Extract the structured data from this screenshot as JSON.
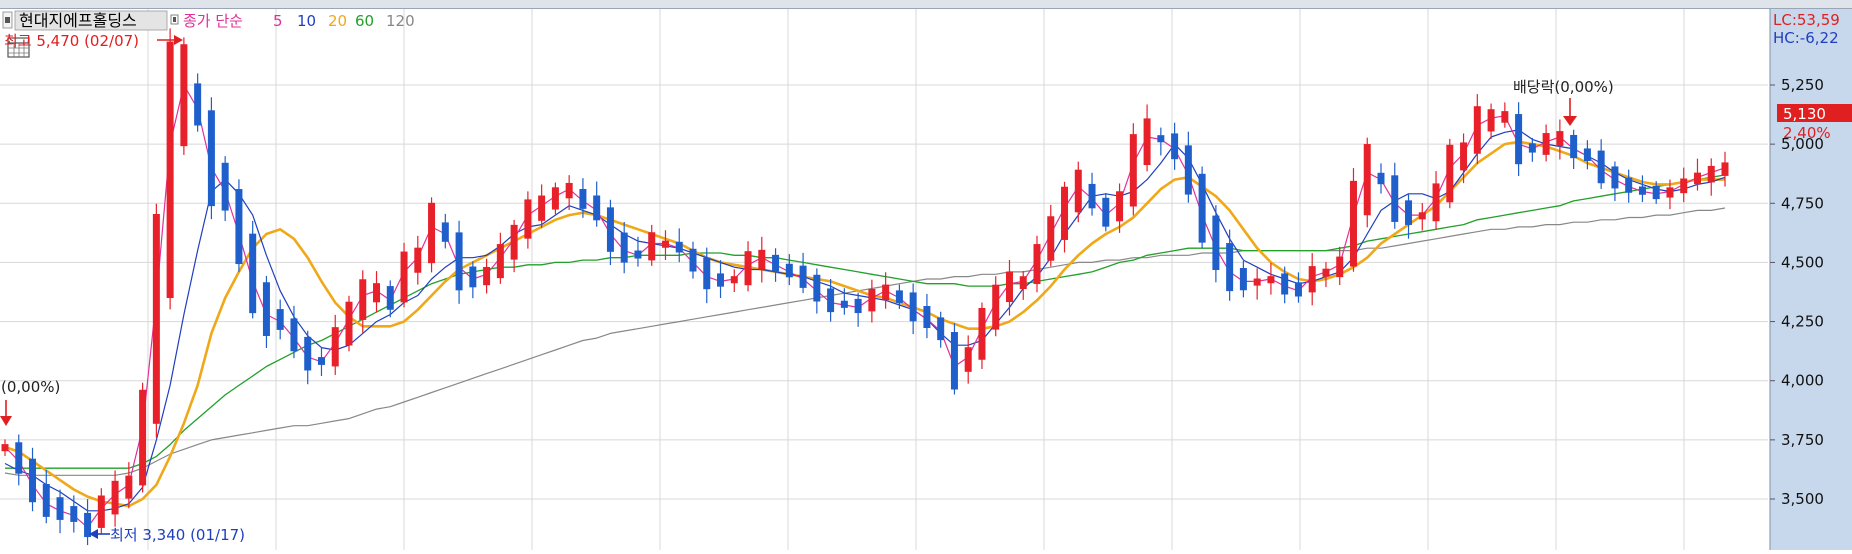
{
  "header": {
    "stock_name": "현대지에프홀딩스",
    "indicator_label": "종가 단순",
    "ma_periods": [
      "5",
      "10",
      "20",
      "60",
      "120"
    ],
    "ma_colors": [
      "#e0309a",
      "#1f3fbf",
      "#f0a818",
      "#22a02a",
      "#888888"
    ]
  },
  "right_top": {
    "lc": "LC:53,59",
    "hc": "HC:-6,22"
  },
  "current": {
    "price_label": "5,130",
    "change_label": "2,40%",
    "color": "#e02020"
  },
  "annotations": {
    "high_label": "최고 5,470 (02/07)",
    "low_label": "최저 3,340 (01/17)",
    "dividend_label": "배당락(0,00%)",
    "left_pct_label": "(0,00%)"
  },
  "colors": {
    "up": "#e8202a",
    "down": "#1f5fcc",
    "grid": "#d8d8d8",
    "axis_bg": "#c8d8ec"
  },
  "chart_data": {
    "type": "candlestick",
    "y_axis": {
      "ticks": [
        "5,250",
        "5,000",
        "4,750",
        "4,500",
        "4,250",
        "4,000",
        "3,750",
        "3,500"
      ],
      "range": [
        3300,
        5550
      ]
    },
    "high": {
      "value": 5470,
      "date": "02/07"
    },
    "low": {
      "value": 3340,
      "date": "01/17"
    },
    "last_close": 5130,
    "change_pct": 2.4,
    "series": [
      {
        "name": "5",
        "values": [
          3720,
          3660,
          3560,
          3480,
          3450,
          3430,
          3380,
          3460,
          3520,
          3560,
          3800,
          4350,
          5000,
          5250,
          5150,
          4900,
          4800,
          4620,
          4420,
          4280,
          4250,
          4180,
          4100,
          4080,
          4160,
          4260,
          4360,
          4380,
          4340,
          4460,
          4520,
          4650,
          4620,
          4480,
          4430,
          4450,
          4520,
          4600,
          4700,
          4740,
          4780,
          4810,
          4760,
          4720,
          4620,
          4550,
          4530,
          4580,
          4580,
          4560,
          4500,
          4440,
          4420,
          4430,
          4490,
          4520,
          4490,
          4460,
          4430,
          4380,
          4330,
          4320,
          4310,
          4350,
          4380,
          4350,
          4300,
          4260,
          4210,
          4060,
          4100,
          4220,
          4330,
          4410,
          4420,
          4510,
          4620,
          4730,
          4820,
          4770,
          4700,
          4750,
          4920,
          5030,
          5020,
          4980,
          4870,
          4700,
          4560,
          4460,
          4420,
          4420,
          4430,
          4400,
          4380,
          4440,
          4460,
          4490,
          4700,
          4880,
          4850,
          4750,
          4700,
          4700,
          4770,
          4900,
          4960,
          5080,
          5110,
          5120,
          5000,
          4980,
          5010,
          5030,
          4980,
          4950,
          4890,
          4850,
          4820,
          4800,
          4790,
          4800,
          4830,
          4860,
          4880,
          4900
        ]
      },
      {
        "name": "10",
        "values": [
          3650,
          3620,
          3600,
          3560,
          3530,
          3490,
          3450,
          3450,
          3460,
          3480,
          3550,
          3750,
          3980,
          4280,
          4550,
          4800,
          4850,
          4790,
          4700,
          4530,
          4380,
          4270,
          4190,
          4140,
          4130,
          4150,
          4200,
          4250,
          4280,
          4330,
          4360,
          4430,
          4480,
          4520,
          4520,
          4530,
          4570,
          4620,
          4650,
          4660,
          4700,
          4740,
          4720,
          4700,
          4660,
          4620,
          4590,
          4580,
          4570,
          4560,
          4540,
          4520,
          4500,
          4480,
          4470,
          4470,
          4460,
          4450,
          4440,
          4420,
          4400,
          4370,
          4360,
          4350,
          4340,
          4320,
          4300,
          4260,
          4200,
          4150,
          4150,
          4170,
          4240,
          4310,
          4390,
          4440,
          4520,
          4620,
          4700,
          4780,
          4790,
          4780,
          4800,
          4850,
          4920,
          5000,
          4940,
          4830,
          4710,
          4600,
          4510,
          4480,
          4450,
          4430,
          4410,
          4420,
          4440,
          4460,
          4520,
          4620,
          4720,
          4760,
          4790,
          4790,
          4770,
          4800,
          4880,
          4960,
          5030,
          5050,
          5060,
          5020,
          5000,
          4990,
          4980,
          4950,
          4920,
          4880,
          4850,
          4830,
          4810,
          4800,
          4810,
          4830,
          4840,
          4860
        ]
      },
      {
        "name": "20",
        "values": [
          3720,
          3700,
          3660,
          3620,
          3580,
          3540,
          3510,
          3490,
          3480,
          3470,
          3500,
          3560,
          3680,
          3820,
          3980,
          4200,
          4350,
          4460,
          4560,
          4620,
          4640,
          4600,
          4520,
          4420,
          4330,
          4270,
          4230,
          4230,
          4230,
          4250,
          4300,
          4360,
          4420,
          4470,
          4500,
          4530,
          4560,
          4590,
          4620,
          4650,
          4680,
          4700,
          4710,
          4700,
          4680,
          4660,
          4640,
          4620,
          4600,
          4580,
          4550,
          4520,
          4500,
          4490,
          4480,
          4470,
          4460,
          4450,
          4440,
          4430,
          4420,
          4400,
          4380,
          4360,
          4350,
          4330,
          4310,
          4290,
          4260,
          4240,
          4220,
          4220,
          4230,
          4250,
          4290,
          4340,
          4400,
          4470,
          4530,
          4580,
          4620,
          4650,
          4690,
          4750,
          4810,
          4850,
          4860,
          4820,
          4780,
          4720,
          4640,
          4560,
          4500,
          4460,
          4430,
          4420,
          4430,
          4450,
          4480,
          4520,
          4580,
          4620,
          4660,
          4700,
          4740,
          4800,
          4860,
          4920,
          4960,
          5000,
          5010,
          5000,
          4990,
          4970,
          4950,
          4920,
          4900,
          4880,
          4860,
          4840,
          4830,
          4830,
          4840,
          4850,
          4850,
          4850
        ]
      },
      {
        "name": "60",
        "values": [
          3630,
          3630,
          3630,
          3630,
          3630,
          3630,
          3630,
          3630,
          3630,
          3630,
          3650,
          3680,
          3730,
          3790,
          3840,
          3890,
          3940,
          3980,
          4020,
          4060,
          4090,
          4120,
          4150,
          4170,
          4200,
          4230,
          4260,
          4290,
          4320,
          4350,
          4380,
          4410,
          4430,
          4450,
          4460,
          4470,
          4480,
          4480,
          4490,
          4490,
          4500,
          4500,
          4510,
          4510,
          4520,
          4520,
          4530,
          4530,
          4530,
          4530,
          4540,
          4540,
          4540,
          4530,
          4530,
          4520,
          4520,
          4510,
          4500,
          4490,
          4480,
          4470,
          4460,
          4450,
          4440,
          4430,
          4420,
          4410,
          4410,
          4410,
          4400,
          4400,
          4400,
          4410,
          4410,
          4420,
          4430,
          4440,
          4450,
          4460,
          4480,
          4500,
          4510,
          4530,
          4540,
          4550,
          4560,
          4560,
          4560,
          4560,
          4550,
          4550,
          4550,
          4550,
          4550,
          4550,
          4550,
          4560,
          4570,
          4590,
          4600,
          4610,
          4620,
          4630,
          4640,
          4650,
          4660,
          4680,
          4690,
          4700,
          4710,
          4720,
          4730,
          4740,
          4760,
          4770,
          4780,
          4790,
          4800,
          4810,
          4820,
          4830,
          4840,
          4850,
          4860,
          4870
        ]
      },
      {
        "name": "120",
        "values": [
          3610,
          3600,
          3600,
          3600,
          3600,
          3600,
          3600,
          3600,
          3600,
          3610,
          3630,
          3660,
          3690,
          3710,
          3730,
          3750,
          3760,
          3770,
          3780,
          3790,
          3800,
          3810,
          3810,
          3820,
          3830,
          3840,
          3860,
          3880,
          3890,
          3910,
          3930,
          3950,
          3970,
          3990,
          4010,
          4030,
          4050,
          4070,
          4090,
          4110,
          4130,
          4150,
          4170,
          4180,
          4200,
          4210,
          4220,
          4230,
          4240,
          4250,
          4260,
          4270,
          4280,
          4290,
          4300,
          4310,
          4320,
          4330,
          4340,
          4350,
          4360,
          4370,
          4380,
          4390,
          4400,
          4410,
          4420,
          4430,
          4430,
          4440,
          4440,
          4450,
          4450,
          4460,
          4460,
          4470,
          4480,
          4490,
          4500,
          4500,
          4510,
          4510,
          4520,
          4520,
          4530,
          4530,
          4530,
          4540,
          4540,
          4540,
          4550,
          4550,
          4550,
          4550,
          4550,
          4550,
          4550,
          4550,
          4550,
          4560,
          4560,
          4570,
          4580,
          4590,
          4600,
          4610,
          4620,
          4630,
          4640,
          4640,
          4650,
          4650,
          4660,
          4660,
          4670,
          4670,
          4680,
          4680,
          4690,
          4690,
          4700,
          4700,
          4710,
          4720,
          4720,
          4730
        ]
      }
    ]
  }
}
